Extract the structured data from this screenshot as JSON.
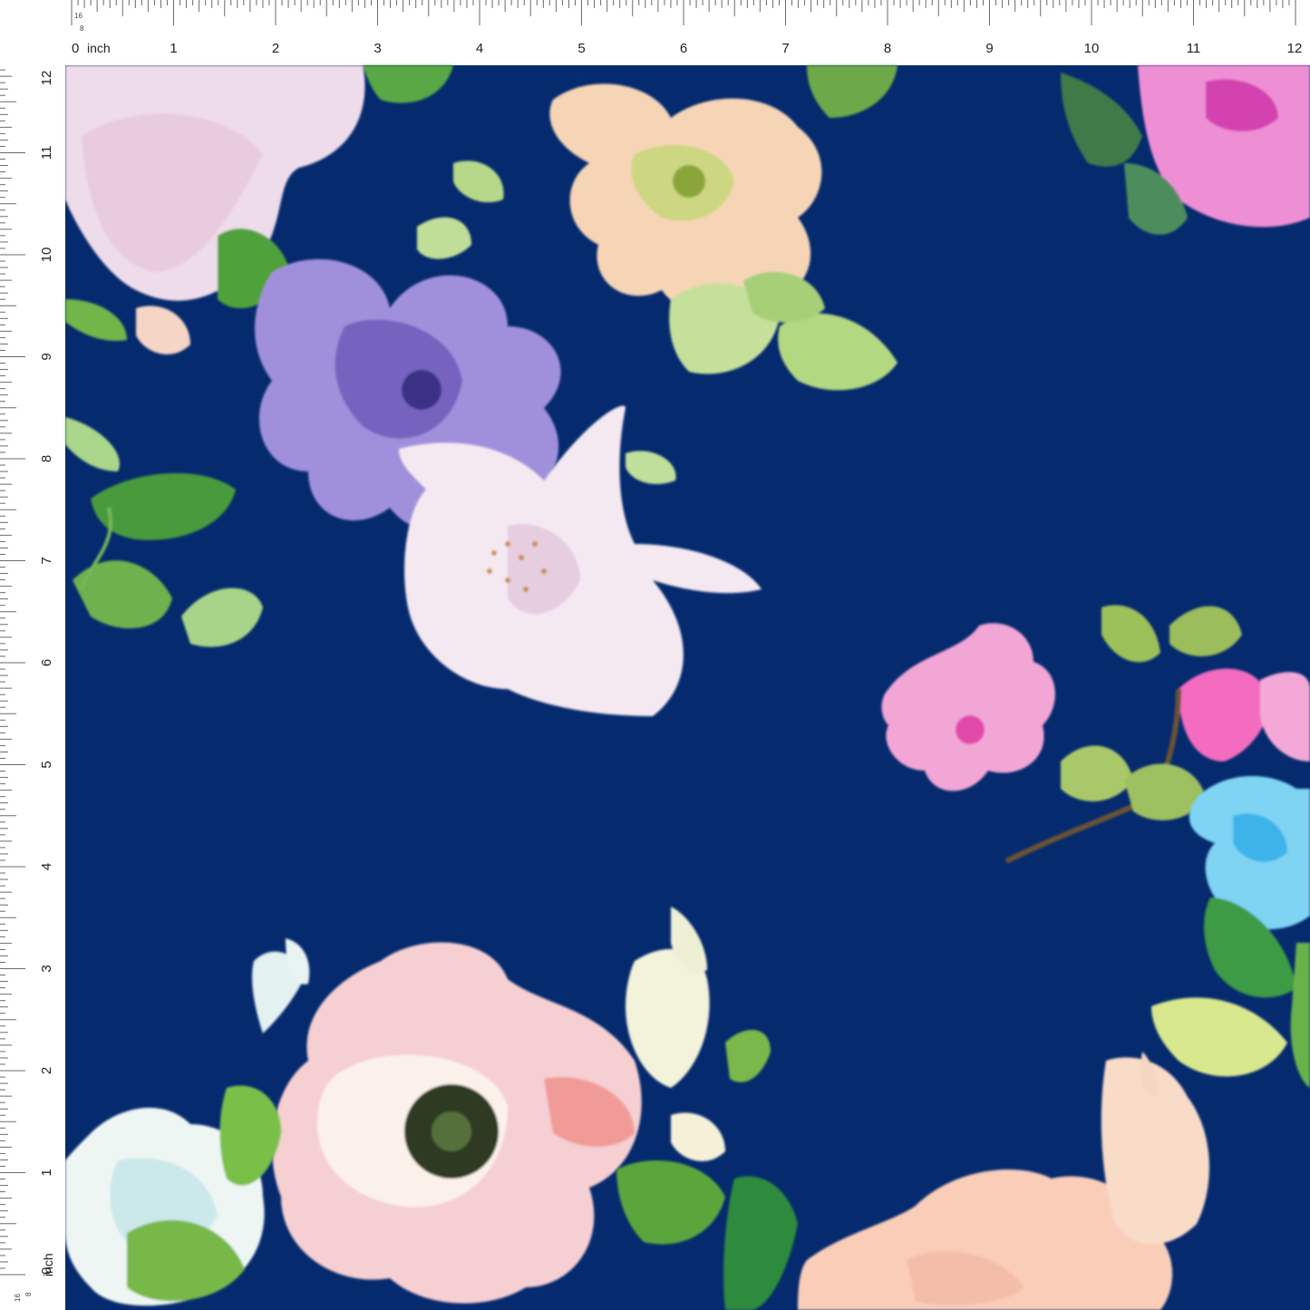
{
  "rulers": {
    "unit_label": "inch",
    "fraction_marks": [
      "16",
      "8"
    ],
    "top_labels": [
      "0",
      "1",
      "2",
      "3",
      "4",
      "5",
      "6",
      "7",
      "8",
      "9",
      "10",
      "11",
      "12"
    ],
    "left_labels": [
      "0",
      "1",
      "2",
      "3",
      "4",
      "5",
      "6",
      "7",
      "8",
      "9",
      "10",
      "11",
      "12"
    ]
  },
  "fabric": {
    "background_color": "#052a6e",
    "palette": {
      "blush": "#f3c7c7",
      "pink": "#e85bb0",
      "lavender": "#8e7bd1",
      "peach": "#f6d0ae",
      "white": "#f4eef3",
      "leaf": "#7fbf4a",
      "sky": "#5cc7ef"
    },
    "icons": [
      "flower-motif",
      "leaf-motif"
    ]
  }
}
